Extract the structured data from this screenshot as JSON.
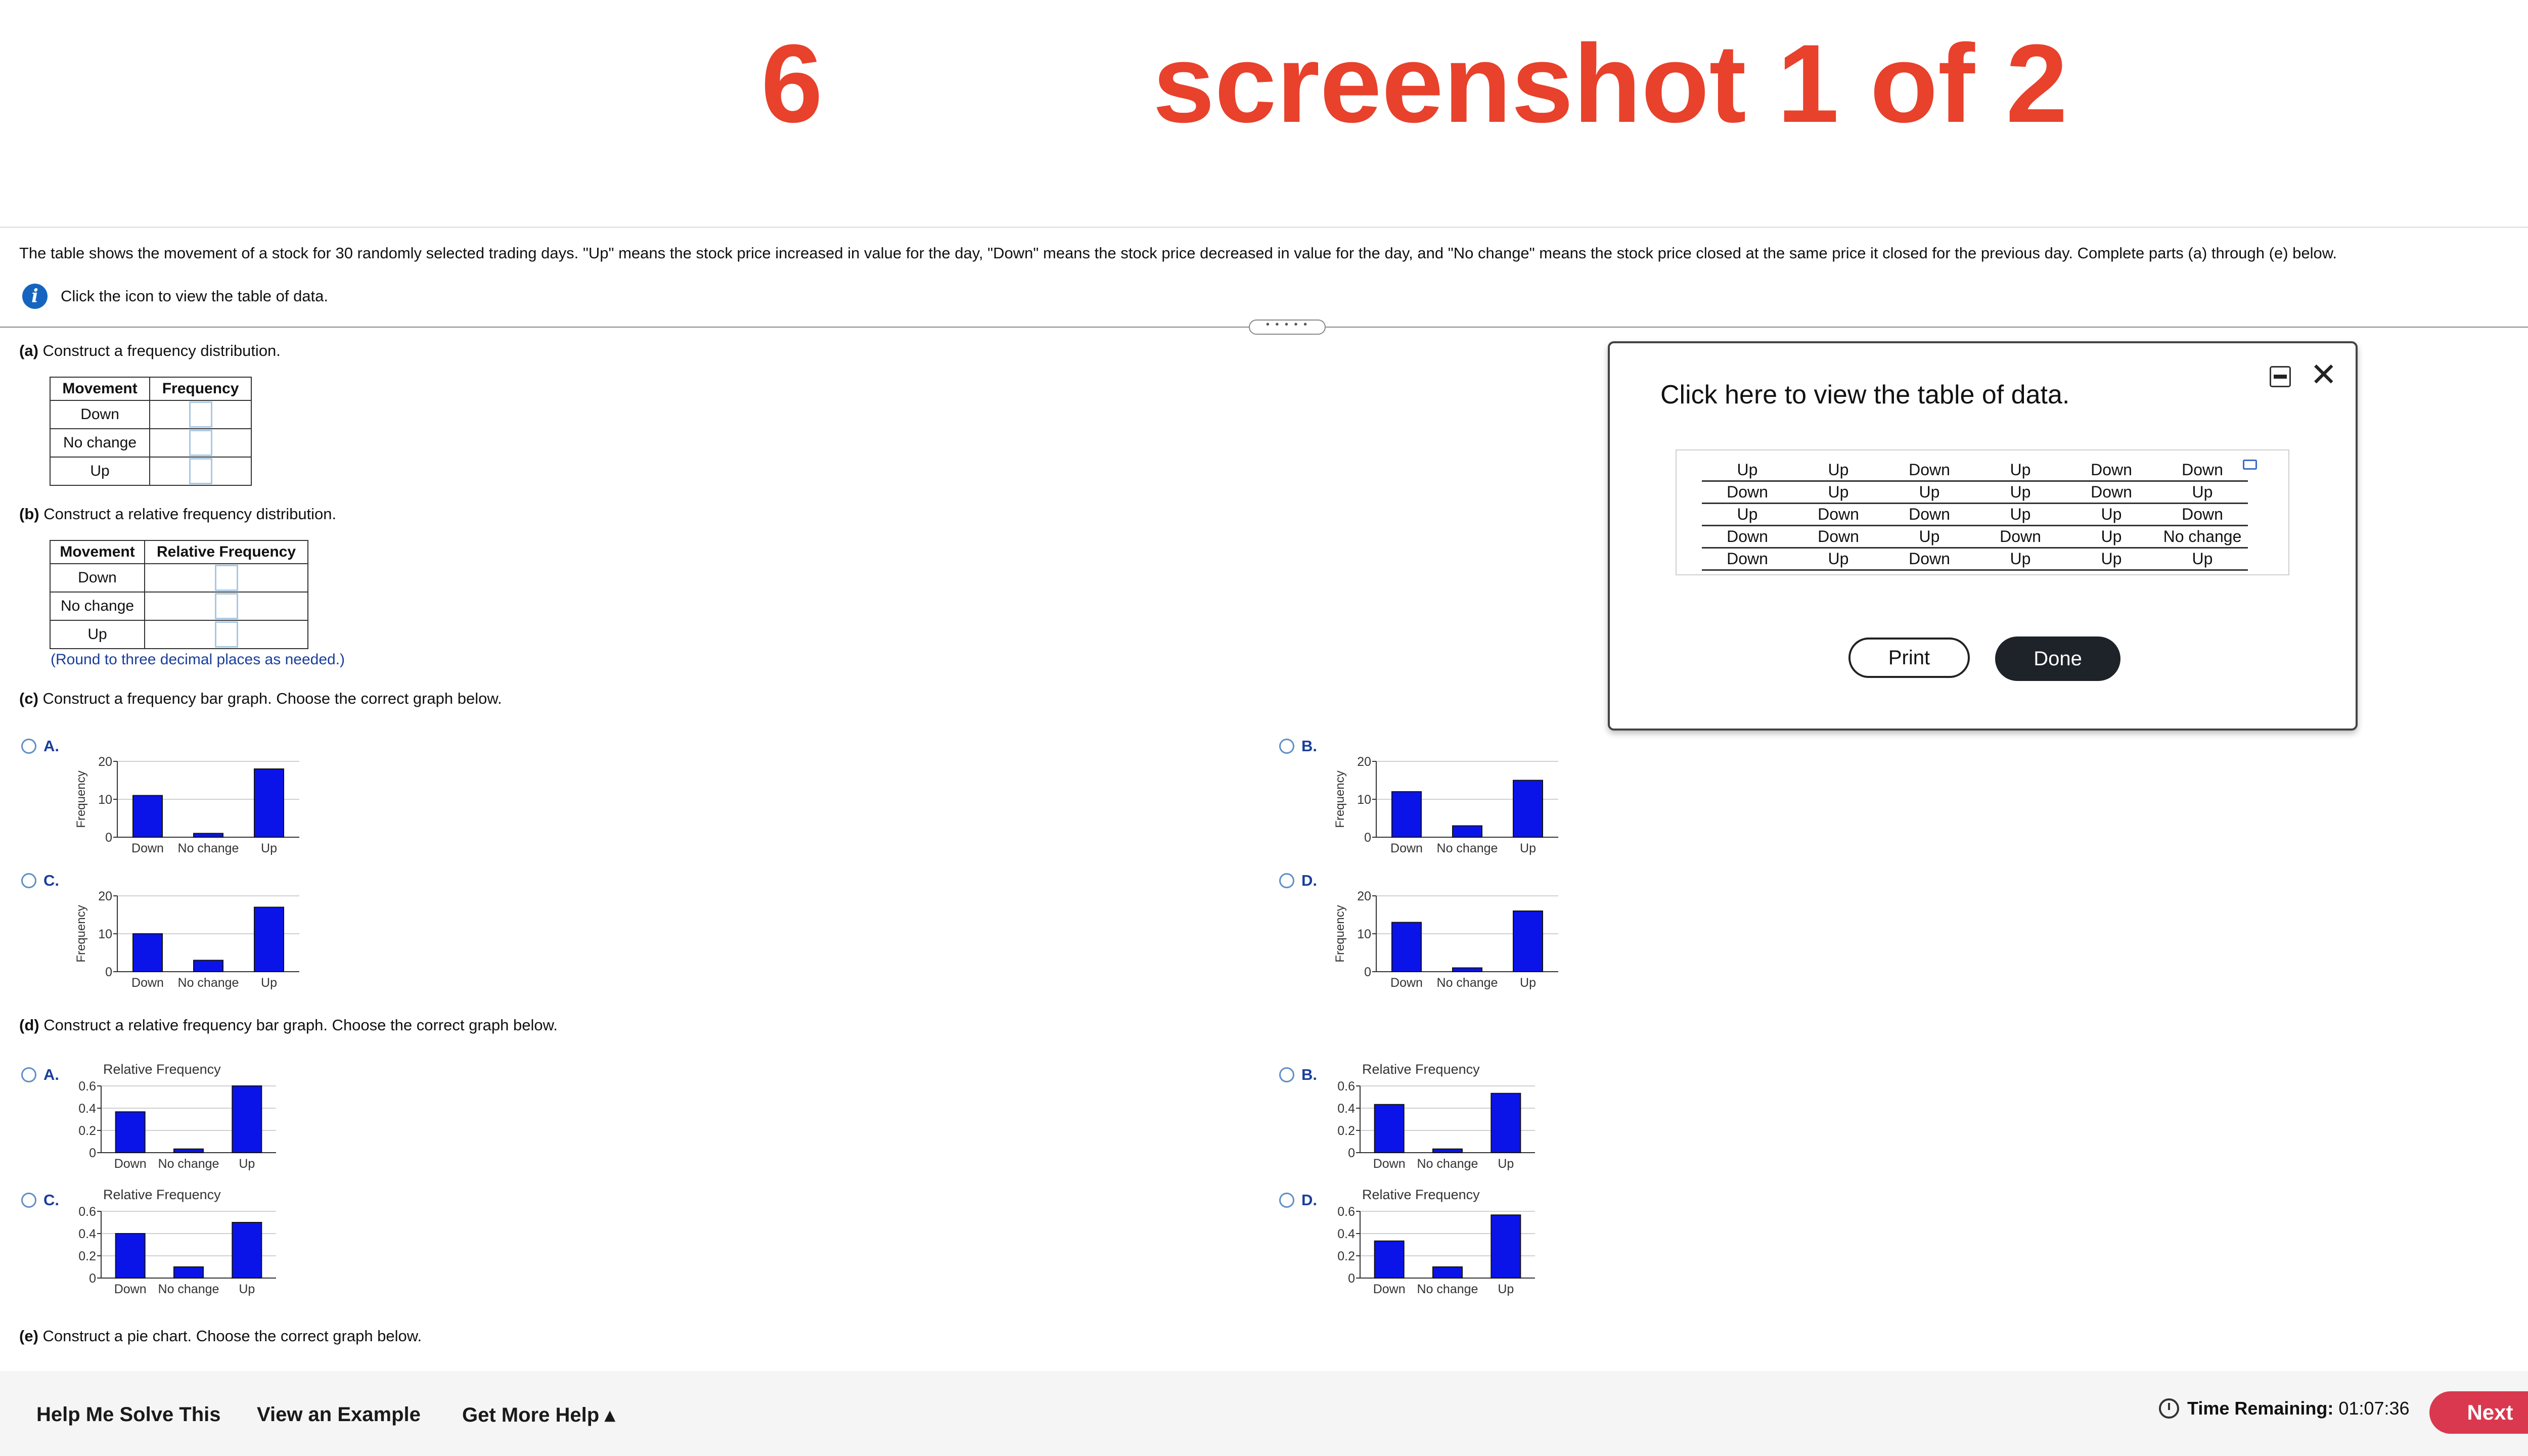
{
  "caption": {
    "number": "6",
    "text": "screenshot 1 of 2",
    "color": "#e8412c"
  },
  "prompt": "The table shows the movement of a stock for 30 randomly selected trading days. \"Up\" means the stock price increased in value for the day, \"Down\" means the stock price decreased in value for the day, and \"No change\" means the stock price closed at the same price it closed for the previous day. Complete parts (a) through (e) below.",
  "info_text": "Click the icon to view the table of data.",
  "handle_glyph": "• • • • •",
  "part_a": {
    "label": "(a)",
    "text": " Construct a frequency distribution.",
    "headers": [
      "Movement",
      "Frequency"
    ],
    "rows": [
      "Down",
      "No change",
      "Up"
    ]
  },
  "part_b": {
    "label": "(b)",
    "text": " Construct a relative frequency distribution.",
    "headers": [
      "Movement",
      "Relative Frequency"
    ],
    "rows": [
      "Down",
      "No change",
      "Up"
    ],
    "note": "(Round to three decimal places as needed.)"
  },
  "part_c": {
    "label": "(c)",
    "text": " Construct a frequency bar graph. Choose the correct graph below."
  },
  "part_d": {
    "label": "(d)",
    "text": " Construct a relative frequency bar graph. Choose the correct graph below."
  },
  "part_e": {
    "label": "(e)",
    "text": " Construct a pie chart. Choose the correct graph below."
  },
  "option_letters": [
    "A.",
    "B.",
    "C.",
    "D."
  ],
  "chart_data": [
    {
      "type": "bar",
      "part": "c",
      "option": "A.",
      "categories": [
        "Down",
        "No change",
        "Up"
      ],
      "values": [
        11,
        1,
        18
      ],
      "ylabel": "Frequency",
      "yticks": [
        0,
        10,
        20
      ],
      "ylim": [
        0,
        20
      ]
    },
    {
      "type": "bar",
      "part": "c",
      "option": "B.",
      "categories": [
        "Down",
        "No change",
        "Up"
      ],
      "values": [
        12,
        3,
        15
      ],
      "ylabel": "Frequency",
      "yticks": [
        0,
        10,
        20
      ],
      "ylim": [
        0,
        20
      ]
    },
    {
      "type": "bar",
      "part": "c",
      "option": "C.",
      "categories": [
        "Down",
        "No change",
        "Up"
      ],
      "values": [
        10,
        3,
        17
      ],
      "ylabel": "Frequency",
      "yticks": [
        0,
        10,
        20
      ],
      "ylim": [
        0,
        20
      ]
    },
    {
      "type": "bar",
      "part": "c",
      "option": "D.",
      "categories": [
        "Down",
        "No change",
        "Up"
      ],
      "values": [
        13,
        1,
        16
      ],
      "ylabel": "Frequency",
      "yticks": [
        0,
        10,
        20
      ],
      "ylim": [
        0,
        20
      ]
    },
    {
      "type": "bar",
      "part": "d",
      "option": "A.",
      "title": "Relative Frequency",
      "categories": [
        "Down",
        "No change",
        "Up"
      ],
      "values": [
        0.367,
        0.033,
        0.6
      ],
      "yticks": [
        "0",
        "0.2",
        "0.4",
        "0.6"
      ],
      "ylim": [
        0,
        0.6
      ]
    },
    {
      "type": "bar",
      "part": "d",
      "option": "B.",
      "title": "Relative Frequency",
      "categories": [
        "Down",
        "No change",
        "Up"
      ],
      "values": [
        0.433,
        0.033,
        0.533
      ],
      "yticks": [
        "0",
        "0.2",
        "0.4",
        "0.6"
      ],
      "ylim": [
        0,
        0.6
      ]
    },
    {
      "type": "bar",
      "part": "d",
      "option": "C.",
      "title": "Relative Frequency",
      "categories": [
        "Down",
        "No change",
        "Up"
      ],
      "values": [
        0.4,
        0.1,
        0.5
      ],
      "yticks": [
        "0",
        "0.2",
        "0.4",
        "0.6"
      ],
      "ylim": [
        0,
        0.6
      ]
    },
    {
      "type": "bar",
      "part": "d",
      "option": "D.",
      "title": "Relative Frequency",
      "categories": [
        "Down",
        "No change",
        "Up"
      ],
      "values": [
        0.333,
        0.1,
        0.567
      ],
      "yticks": [
        "0",
        "0.2",
        "0.4",
        "0.6"
      ],
      "ylim": [
        0,
        0.6
      ]
    }
  ],
  "bar_color": "#0a14e8",
  "dialog": {
    "title": "Click here to view the table of data.",
    "table": [
      [
        "Up",
        "Up",
        "Down",
        "Up",
        "Down",
        "Down"
      ],
      [
        "Down",
        "Up",
        "Up",
        "Up",
        "Down",
        "Up"
      ],
      [
        "Up",
        "Down",
        "Down",
        "Up",
        "Up",
        "Down"
      ],
      [
        "Down",
        "Down",
        "Up",
        "Down",
        "Up",
        "No change"
      ],
      [
        "Down",
        "Up",
        "Down",
        "Up",
        "Up",
        "Up"
      ]
    ],
    "print_label": "Print",
    "done_label": "Done",
    "close_glyph": "✕"
  },
  "footer": {
    "help_solve": "Help Me Solve This",
    "view_example": "View an Example",
    "more_help": "Get More Help ▴",
    "timer_label": "Time Remaining:",
    "timer_value": "01:07:36",
    "next_label": "Next"
  }
}
